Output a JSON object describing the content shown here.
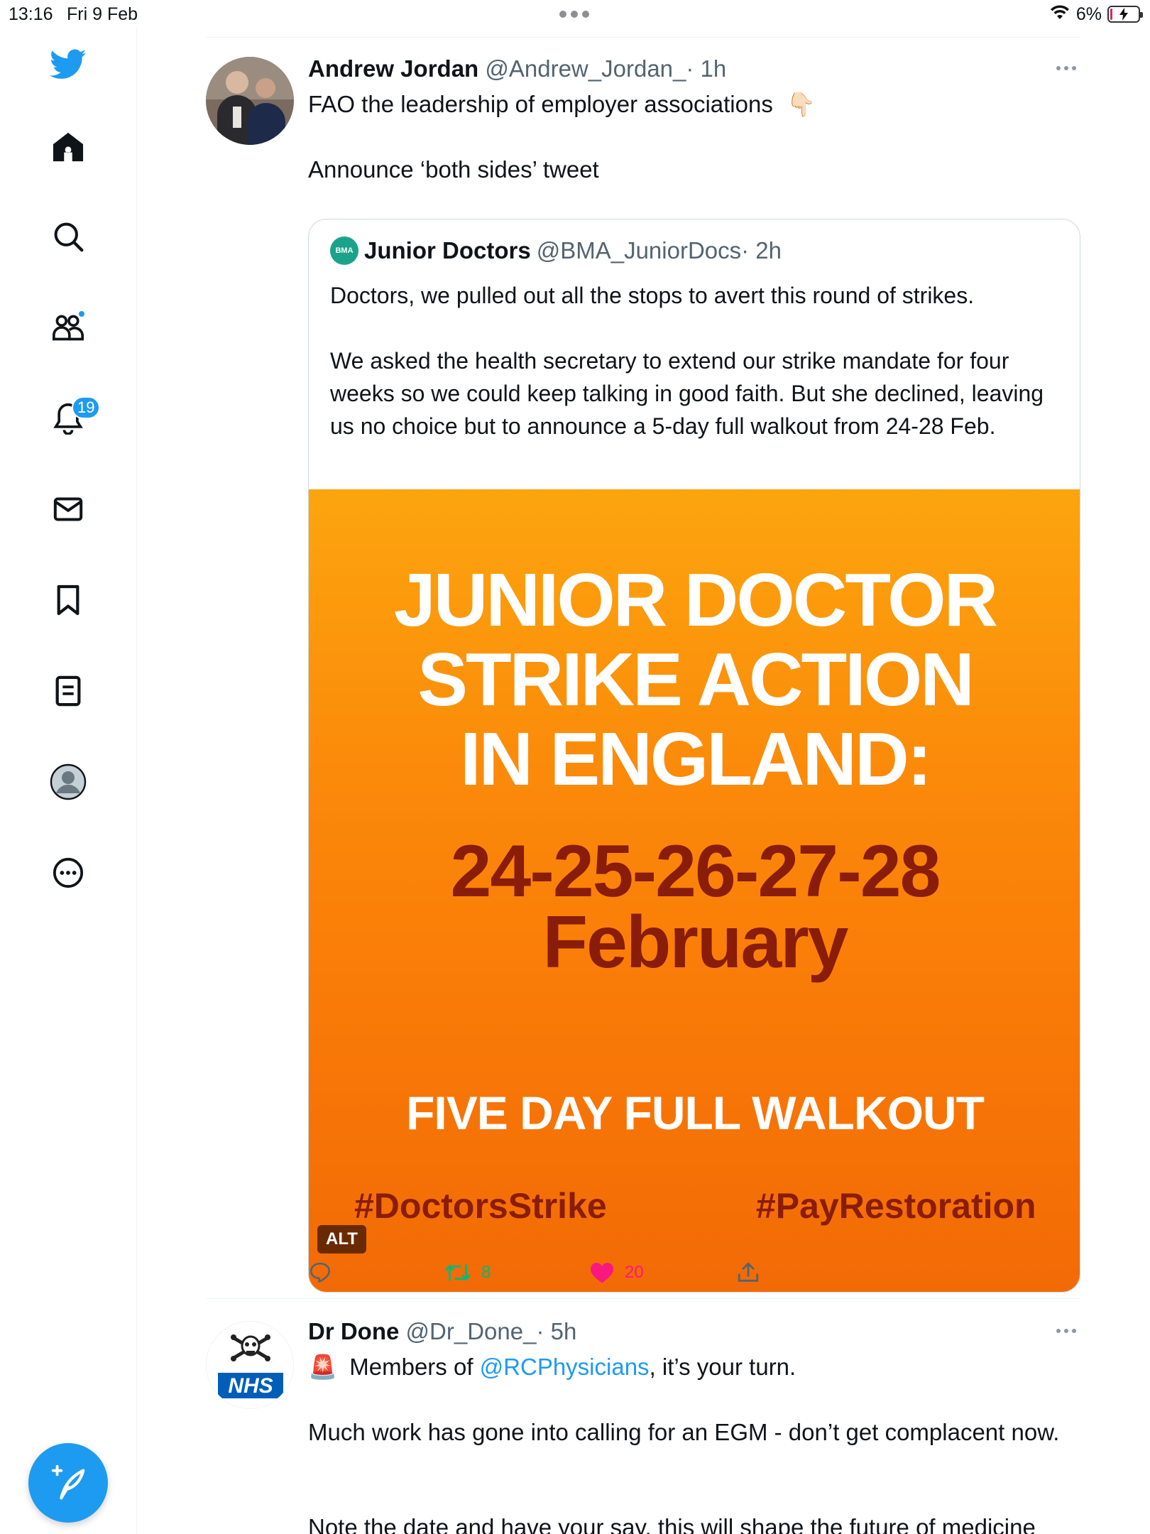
{
  "status_bar": {
    "time": "13:16",
    "date": "Fri 9 Feb",
    "battery": "6%",
    "battery_level": 0.06
  },
  "sidebar": {
    "items": [
      {
        "name": "twitter-logo",
        "icon": "bird-icon"
      },
      {
        "name": "home",
        "icon": "home-icon"
      },
      {
        "name": "explore",
        "icon": "search-icon"
      },
      {
        "name": "communities",
        "icon": "people-icon",
        "has_dot": true
      },
      {
        "name": "notifications",
        "icon": "bell-icon",
        "badge": "19"
      },
      {
        "name": "messages",
        "icon": "mail-icon"
      },
      {
        "name": "bookmarks",
        "icon": "bookmark-icon"
      },
      {
        "name": "lists",
        "icon": "list-icon"
      },
      {
        "name": "profile",
        "icon": "avatar-icon"
      },
      {
        "name": "more",
        "icon": "more-circle-icon"
      }
    ],
    "compose_icon": "feather-plus-icon"
  },
  "colors": {
    "accent": "#1d9bf0",
    "like": "#f91880",
    "retweet": "#00ba7c",
    "poster_dark_red": "#8a1c0a"
  },
  "tweet1": {
    "name": "Andrew Jordan",
    "handle": "@Andrew_Jordan_",
    "time": "· 1h",
    "line1": "FAO the leadership of employer associations",
    "emoji": "👇🏻",
    "line2": "Announce ‘both sides’ tweet",
    "quote": {
      "avatar_label": "BMA",
      "name": "Junior Doctors",
      "handle": "@BMA_JuniorDocs",
      "time": "· 2h",
      "para1": "Doctors, we pulled out all the stops to avert this round of strikes.",
      "para2": "We asked the health secretary to extend our strike mandate for four weeks so we could keep talking in good faith. But she declined, leaving us no choice but to announce a 5-day full walkout from 24-28 Feb.",
      "poster": {
        "title1": "JUNIOR DOCTOR",
        "title2": "STRIKE ACTION",
        "title3": "IN ENGLAND:",
        "dates": "24-25-26-27-28",
        "month": "February",
        "walkout": "FIVE DAY FULL WALKOUT",
        "tag1": "#DoctorsStrike",
        "tag2": "#PayRestoration",
        "alt": "ALT"
      }
    },
    "actions": {
      "retweets": "8",
      "likes": "20"
    }
  },
  "tweet2": {
    "name": "Dr Done",
    "handle": "@Dr_Done_",
    "time": "· 5h",
    "avatar_label": "NHS",
    "siren": "🚨",
    "line1_pre": "Members of ",
    "mention": "@RCPhysicians",
    "line1_post": ", it’s your turn.",
    "para2": "Much work has gone into calling for an EGM - don’t get complacent now.",
    "para3": "Note the date and have your say, this will shape the future of medicine"
  }
}
